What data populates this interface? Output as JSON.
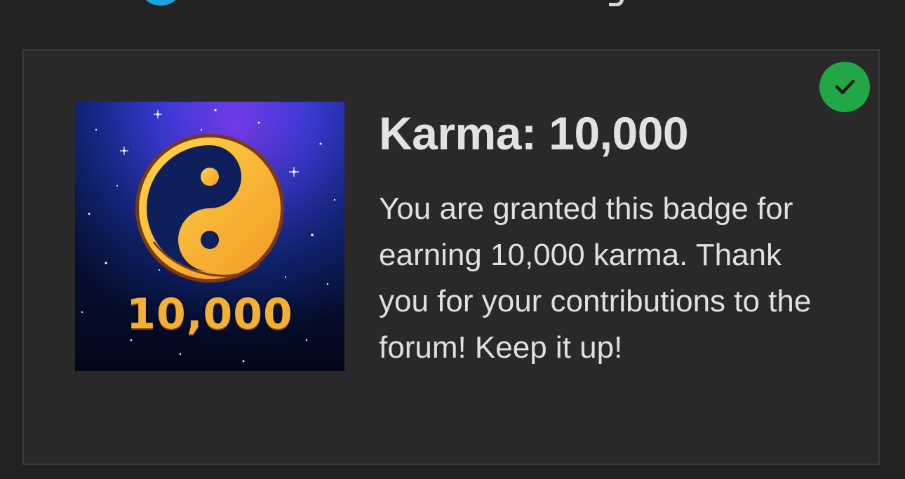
{
  "badge": {
    "title": "Karma: 10,000",
    "description": "You are granted this badge for earning 10,000 karma. Thank you for your contributions to the forum! Keep it up!",
    "image_number": "10,000",
    "earned": true,
    "icon": "yin-yang-icon",
    "status_icon": "checkmark-icon"
  },
  "colors": {
    "page_background": "#222222",
    "card_background": "#292929",
    "card_border": "#3a3a3a",
    "title_text": "#e2e2e2",
    "body_text": "#e0e0e0",
    "earned_badge": "#22a746",
    "badge_gold": "#f2b134",
    "top_avatar": "#1fa2e0"
  }
}
